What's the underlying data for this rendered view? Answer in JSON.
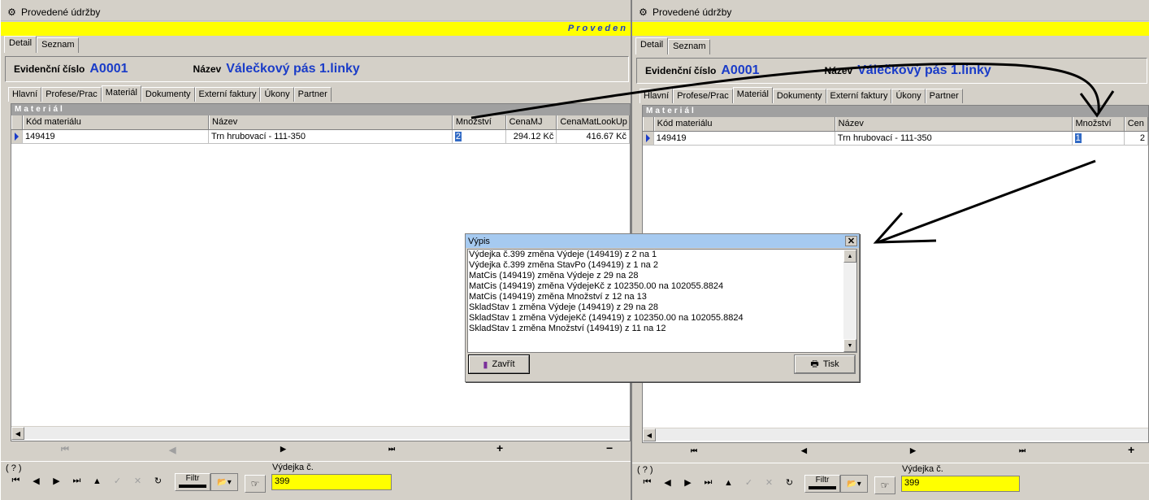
{
  "left": {
    "title": "Provedené údržby",
    "yellow_text": "Proveden",
    "top_tabs": [
      "Detail",
      "Seznam"
    ],
    "evid_label": "Evidenční číslo",
    "evid_value": "A0001",
    "name_label": "Název",
    "name_value": "Válečkový pás 1.linky",
    "sub_tabs": [
      "Hlavní",
      "Profese/Prac",
      "Materiál",
      "Dokumenty",
      "Externí faktury",
      "Úkony",
      "Partner"
    ],
    "panel_title": "Materiál",
    "columns": [
      "Kód materiálu",
      "Název",
      "Množství",
      "CenaMJ",
      "CenaMatLookUp"
    ],
    "row": {
      "kod": "149419",
      "nazev": "Trn hrubovací - 111-350",
      "mnozstvi": "2",
      "cenamj": "294.12 Kč",
      "cenamat": "416.67 Kč"
    },
    "help": "( ? )",
    "filtr": "Filtr",
    "vydejka_label": "Výdejka č.",
    "vydejka_value": "399"
  },
  "right": {
    "title": "Provedené údržby",
    "top_tabs": [
      "Detail",
      "Seznam"
    ],
    "evid_label": "Evidenční číslo",
    "evid_value": "A0001",
    "name_label": "Název",
    "name_value": "Válečkový pás 1.linky",
    "sub_tabs": [
      "Hlavní",
      "Profese/Prac",
      "Materiál",
      "Dokumenty",
      "Externí faktury",
      "Úkony",
      "Partner"
    ],
    "panel_title": "Materiál",
    "columns": [
      "Kód materiálu",
      "Název",
      "Množství",
      "Cen"
    ],
    "row": {
      "kod": "149419",
      "nazev": "Trn hrubovací - 111-350",
      "mnozstvi": "1",
      "cen": "2"
    },
    "help": "( ? )",
    "filtr": "Filtr",
    "vydejka_label": "Výdejka č.",
    "vydejka_value": "399"
  },
  "dialog": {
    "title": "Výpis",
    "lines": [
      "Výdejka č.399 změna Výdeje (149419) z 2 na 1",
      "Výdejka č.399 změna StavPo (149419) z 1 na 2",
      "MatCis (149419) změna Výdeje z 29 na 28",
      "MatCis (149419) změna VýdejeKč z 102350.00 na 102055.8824",
      "MatCis (149419) změna Množství z 12 na 13",
      "SkladStav 1 změna Výdeje (149419) z 29 na 28",
      "SkladStav 1 změna VýdejeKč (149419) z 102350.00 na 102055.8824",
      "SkladStav 1 změna Množství (149419) z 11 na 12"
    ],
    "close_label": "Zavřít",
    "print_label": "Tisk"
  },
  "colors": {
    "accent": "#1a3cc8",
    "yellow": "#ffff00",
    "dialog_title": "#a6caf0"
  }
}
